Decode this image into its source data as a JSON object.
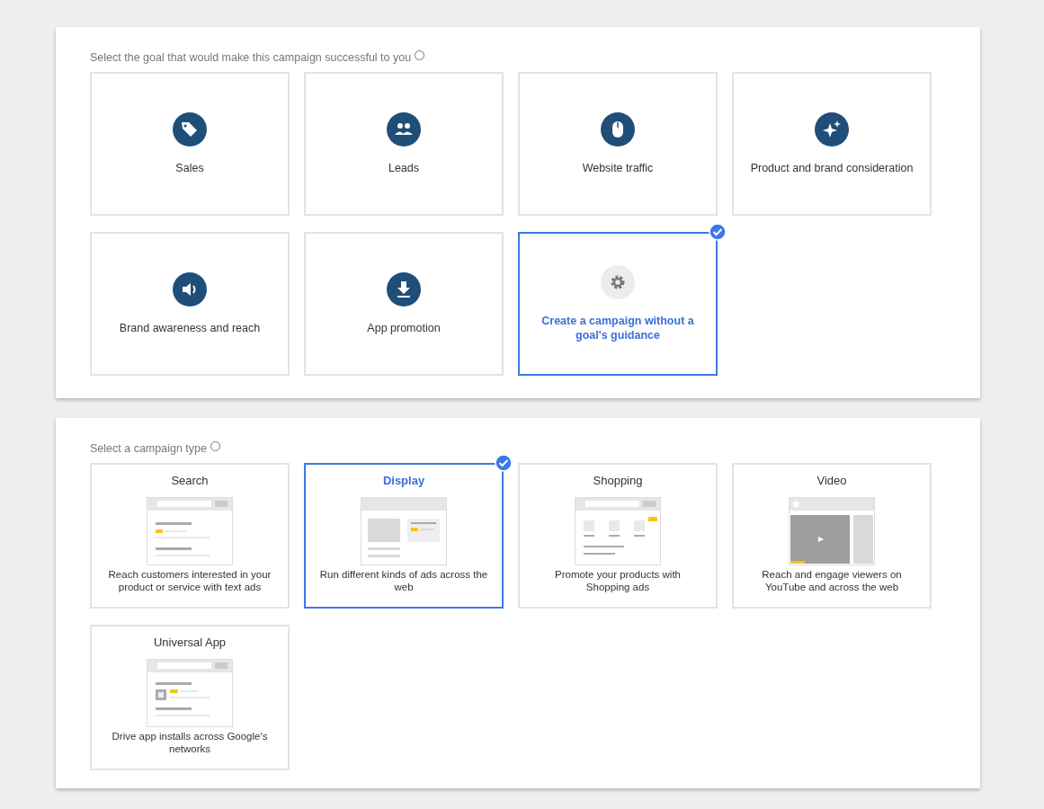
{
  "goal_section": {
    "heading": "Select the goal that would make this campaign successful to you",
    "goals": [
      {
        "label": "Sales",
        "selected": false
      },
      {
        "label": "Leads",
        "selected": false
      },
      {
        "label": "Website traffic",
        "selected": false
      },
      {
        "label": "Product and brand consideration",
        "selected": false
      },
      {
        "label": "Brand awareness and reach",
        "selected": false
      },
      {
        "label": "App promotion",
        "selected": false
      },
      {
        "label": "Create a campaign without a goal's guidance",
        "selected": true
      }
    ]
  },
  "type_section": {
    "heading": "Select a campaign type",
    "types": [
      {
        "title": "Search",
        "description": "Reach customers interested in your product or service with text ads",
        "selected": false
      },
      {
        "title": "Display",
        "description": "Run different kinds of ads across the web",
        "selected": true
      },
      {
        "title": "Shopping",
        "description": "Promote your products with Shopping ads",
        "selected": false
      },
      {
        "title": "Video",
        "description": "Reach and engage viewers on YouTube and across the web",
        "selected": false
      },
      {
        "title": "Universal App",
        "description": "Drive app installs across Google's networks",
        "selected": false
      }
    ]
  }
}
